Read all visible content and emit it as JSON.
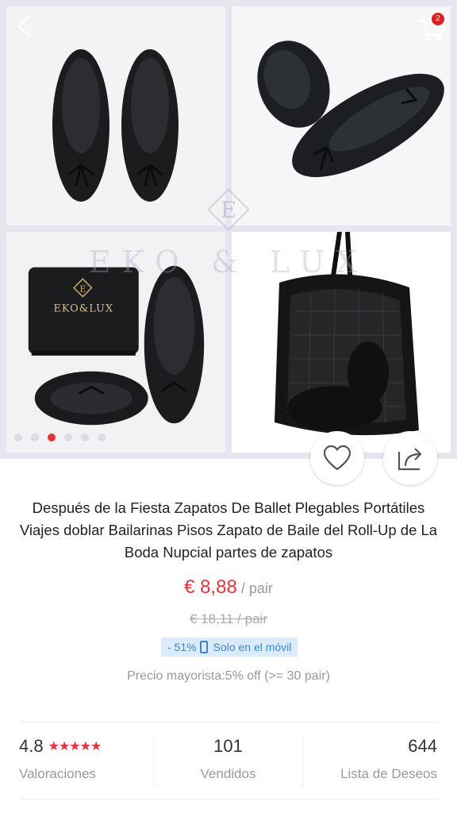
{
  "header": {
    "cart_count": "2"
  },
  "gallery": {
    "watermark_text": "EKO & LUX",
    "watermark_logo_letter": "E",
    "pouch_brand": "EKO&LUX",
    "pouch_logo_letter": "E",
    "dots_count": 6,
    "active_dot": 2
  },
  "product": {
    "title": "Después de la Fiesta Zapatos De Ballet Plegables Portátiles Viajes doblar Bailarinas Pisos Zapato de Baile del Roll-Up de La Boda Nupcial partes de zapatos",
    "price": "€ 8,88",
    "price_unit": " / pair",
    "old_price": "€ 18,11 / pair",
    "discount": "- 51%",
    "promo_text": "Solo en el móvil",
    "wholesale": "Precio mayorista:5% off (>= 30 pair)"
  },
  "stats": {
    "rating": "4.8",
    "stars": "★★★★★",
    "rating_label": "Valoraciones",
    "sold": "101",
    "sold_label": "Vendidos",
    "wishlist": "644",
    "wishlist_label": "Lista de Deseos"
  },
  "colors": {
    "accent": "#e8333a",
    "promo_blue": "#3a86d8"
  }
}
